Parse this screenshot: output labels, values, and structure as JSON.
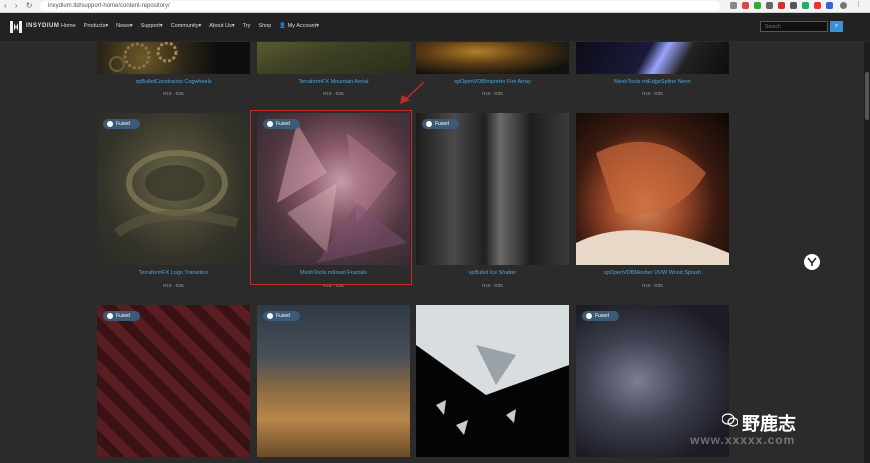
{
  "browser": {
    "url": "inxydium.ltd/support-home/content-repository/"
  },
  "header": {
    "brand": "INSYDIUM",
    "menu": [
      "Home",
      "Products▾",
      "News▾",
      "Support▾",
      "Community▾",
      "About Us▾",
      "Try",
      "Shop",
      "My Account▾"
    ],
    "search_placeholder": "Search"
  },
  "row_top": [
    {
      "title": "xpBulletConstraints Cogwheels",
      "price": "R18 - R35"
    },
    {
      "title": "TerraformFX Mountain Aerial",
      "price": "R18 - R35"
    },
    {
      "title": "xpOpenVDBImporter Fire Array",
      "price": "R18 - R35"
    },
    {
      "title": "MeshTools mtEdgeSpline Neon",
      "price": "R18 - R35"
    }
  ],
  "row_mid": [
    {
      "title": "TerraformFX Logo Transition",
      "price": "R18 - R35",
      "badge": "Fused"
    },
    {
      "title": "MeshTools mtInset Fractals",
      "price": "R18 - R35",
      "badge": "Fused"
    },
    {
      "title": "xpBullet Ice Shatter",
      "price": "R18 - R35",
      "badge": "Fused"
    },
    {
      "title": "xpOpenVDBMesher UVW Wood Splash",
      "price": "R18 - R35"
    }
  ],
  "row_bottom": [
    {
      "badge": "Fused"
    },
    {
      "badge": "Fused"
    },
    {},
    {
      "badge": "Fused"
    }
  ],
  "watermark": {
    "text": "野鹿志",
    "url": "www.xxxxx.com"
  }
}
